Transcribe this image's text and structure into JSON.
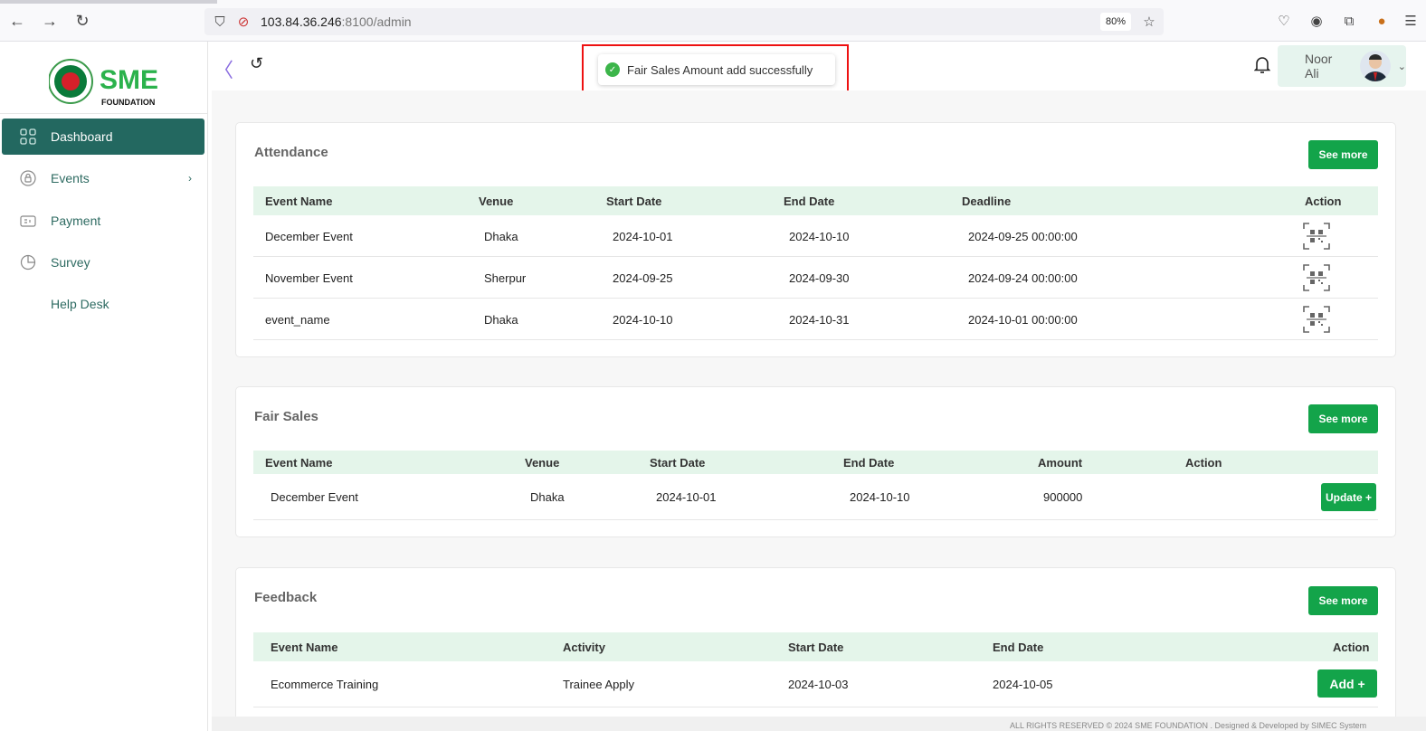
{
  "browser": {
    "url_host": "103.84.36.246",
    "url_path": ":8100/admin",
    "zoom": "80%"
  },
  "sidebar": {
    "logo_text": "SME",
    "logo_subtext": "FOUNDATION",
    "items": [
      {
        "label": "Dashboard",
        "icon": "grid-icon",
        "active": true
      },
      {
        "label": "Events",
        "icon": "lock-icon",
        "chevron": "›"
      },
      {
        "label": "Payment",
        "icon": "card-icon"
      },
      {
        "label": "Survey",
        "icon": "pie-icon"
      },
      {
        "label": "Help Desk",
        "icon": ""
      }
    ]
  },
  "header": {
    "collapse": "〈",
    "back": "↺",
    "toast": "Fair Sales Amount add successfully",
    "user_name": "Noor Ali"
  },
  "attendance": {
    "title": "Attendance",
    "see_more": "See more",
    "columns": [
      "Event Name",
      "Venue",
      "Start Date",
      "End Date",
      "Deadline",
      "Action"
    ],
    "rows": [
      [
        "December Event",
        "Dhaka",
        "2024-10-01",
        "2024-10-10",
        "2024-09-25 00:00:00"
      ],
      [
        "November Event",
        "Sherpur",
        "2024-09-25",
        "2024-09-30",
        "2024-09-24 00:00:00"
      ],
      [
        "event_name",
        "Dhaka",
        "2024-10-10",
        "2024-10-31",
        "2024-10-01 00:00:00"
      ]
    ]
  },
  "fair_sales": {
    "title": "Fair Sales",
    "see_more": "See more",
    "columns": [
      "Event Name",
      "Venue",
      "Start Date",
      "End Date",
      "Amount",
      "Action"
    ],
    "rows": [
      [
        "December Event",
        "Dhaka",
        "2024-10-01",
        "2024-10-10",
        "900000",
        "Update +"
      ]
    ]
  },
  "feedback": {
    "title": "Feedback",
    "see_more": "See more",
    "columns": [
      "Event Name",
      "Activity",
      "Start Date",
      "End Date",
      "Action"
    ],
    "rows": [
      [
        "Ecommerce Training",
        "Trainee Apply",
        "2024-10-03",
        "2024-10-05",
        "Add +"
      ]
    ]
  },
  "footer": "ALL RIGHTS RESERVED © 2024 SME FOUNDATION . Designed & Developed by SIMEC System",
  "colors": {
    "brand": "#236860",
    "accent": "#13a44a",
    "table_header": "#e4f5ea"
  }
}
